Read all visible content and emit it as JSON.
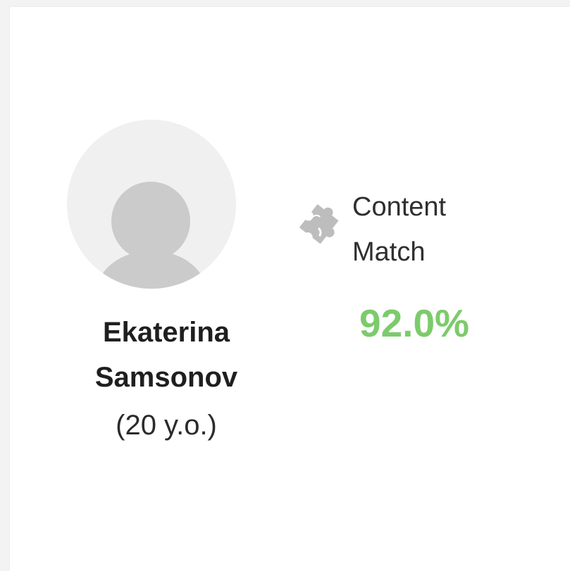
{
  "profile": {
    "first_name": "Ekaterina",
    "last_name": "Samsonov",
    "age": "(20 y.o.)",
    "avatar_icon": "user-placeholder-icon"
  },
  "match": {
    "label_line1": "Content",
    "label_line2": "Match",
    "value": "92.0%",
    "icon": "puzzle-piece-icon",
    "value_color": "#7ccb6c"
  }
}
